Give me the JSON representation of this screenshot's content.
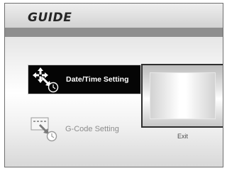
{
  "header": {
    "title": "GUIDE"
  },
  "menu": {
    "items": [
      {
        "label": "Date/Time Setting",
        "icon": "date-time-setting-icon",
        "selected": true
      },
      {
        "label": "G-Code Setting",
        "icon": "g-code-setting-icon",
        "selected": false
      }
    ]
  },
  "preview": {
    "exit_label": "Exit"
  },
  "colors": {
    "selected_bg": "#050505",
    "header_bar": "#8e8e8e",
    "inactive_text": "#8c8c8c"
  }
}
